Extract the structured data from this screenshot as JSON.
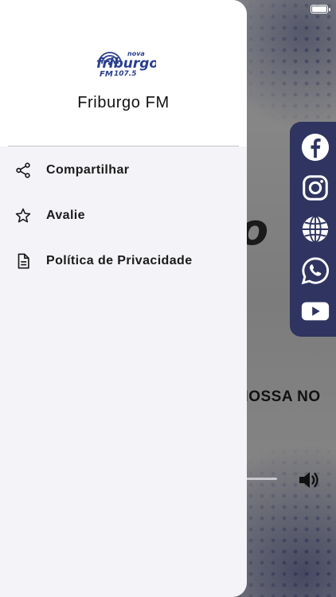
{
  "app": {
    "title": "Friburgo FM"
  },
  "logo": {
    "top_word": "nova",
    "main_word": "friburgo",
    "sub_word": "FM",
    "frequency": "107.5"
  },
  "menu": {
    "items": [
      {
        "label": "Compartilhar",
        "icon": "share-icon"
      },
      {
        "label": "Avalie",
        "icon": "star-icon"
      },
      {
        "label": "Política de Privacidade",
        "icon": "document-icon"
      }
    ]
  },
  "background": {
    "ticker_text": "NOSSA NO",
    "logo_fragment": "o",
    "social_buttons": [
      "facebook-icon",
      "instagram-icon",
      "globe-icon",
      "whatsapp-icon",
      "youtube-icon"
    ]
  },
  "colors": {
    "drawer_bg": "#f4f3f8",
    "header_bg": "#ffffff",
    "social_bar": "#2f3560",
    "logo_blue": "#2a3f8f"
  }
}
